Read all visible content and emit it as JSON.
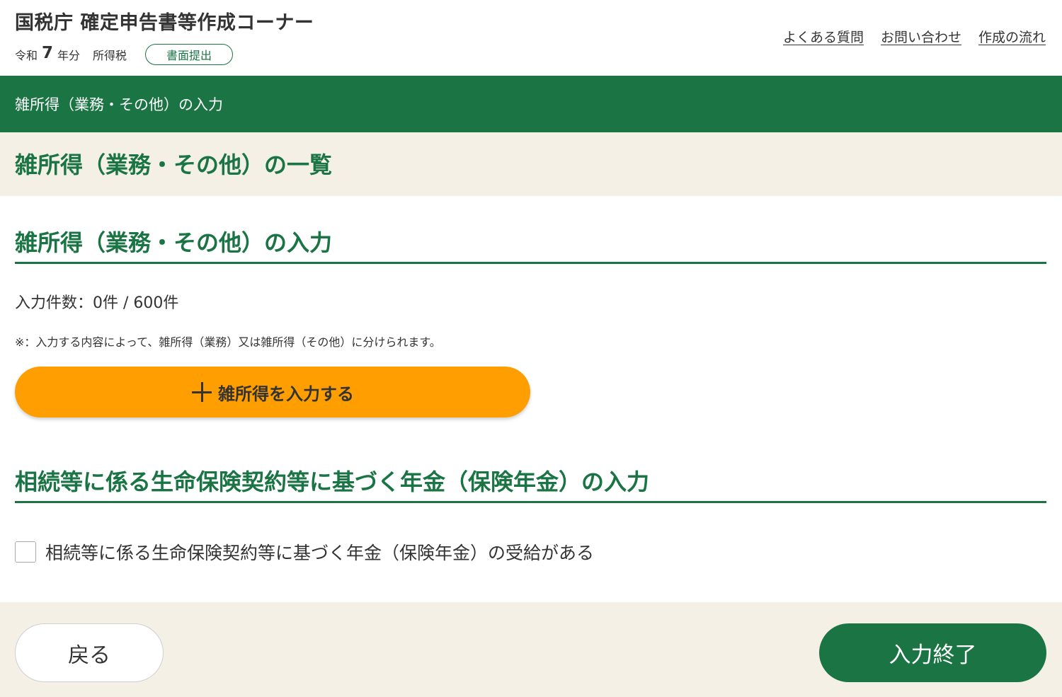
{
  "header": {
    "title": "国税庁 確定申告書等作成コーナー",
    "era": "令和",
    "year": "7",
    "year_unit": "年分",
    "tax_type": "所得税",
    "submission_badge": "書面提出",
    "links": [
      "よくある質問",
      "お問い合わせ",
      "作成の流れ"
    ]
  },
  "green_bar": {
    "title": "雑所得（業務・その他）の入力"
  },
  "list_header": {
    "title": "雑所得（業務・その他）の一覧"
  },
  "misc_income_section": {
    "title": "雑所得（業務・その他）の入力",
    "count_text": "入力件数：0件 / 600件",
    "note": "※：入力する内容によって、雑所得（業務）又は雑所得（その他）に分けられます。",
    "add_button_label": "雑所得を入力する"
  },
  "pension_section": {
    "title": "相続等に係る生命保険契約等に基づく年金（保険年金）の入力",
    "checkbox_label": "相続等に係る生命保険契約等に基づく年金（保険年金）の受給がある",
    "checkbox_checked": false
  },
  "footer": {
    "back_label": "戻る",
    "finish_label": "入力終了"
  },
  "colors": {
    "brand_green": "#1a7444",
    "accent_orange": "#ff9e00",
    "band_beige": "#f4f0e6"
  }
}
